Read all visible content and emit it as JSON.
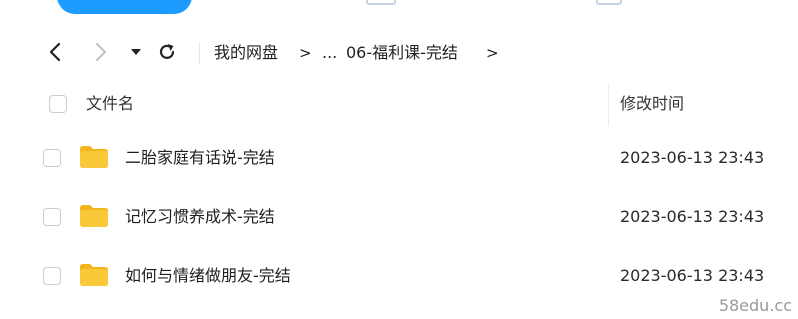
{
  "navigation": {
    "back_icon": "back-arrow-icon",
    "forward_icon": "forward-arrow-icon",
    "dropdown_icon": "dropdown-triangle-icon",
    "refresh_icon": "refresh-icon"
  },
  "breadcrumb": {
    "root": "我的网盘",
    "ellipsis": "...",
    "current": "06-福利课-完结",
    "separator": ">"
  },
  "table": {
    "columns": {
      "name": "文件名",
      "modified": "修改时间"
    },
    "rows": [
      {
        "name": "二胎家庭有话说-完结",
        "modified": "2023-06-13 23:43",
        "icon": "folder-icon"
      },
      {
        "name": "记忆习惯养成术-完结",
        "modified": "2023-06-13 23:43",
        "icon": "folder-icon"
      },
      {
        "name": "如何与情绪做朋友-完结",
        "modified": "2023-06-13 23:43",
        "icon": "folder-icon"
      }
    ]
  },
  "watermark": "58edu.cc",
  "colors": {
    "accent": "#1e9bff",
    "folder": "#f9c93a",
    "folder_tab": "#f3b51b"
  }
}
